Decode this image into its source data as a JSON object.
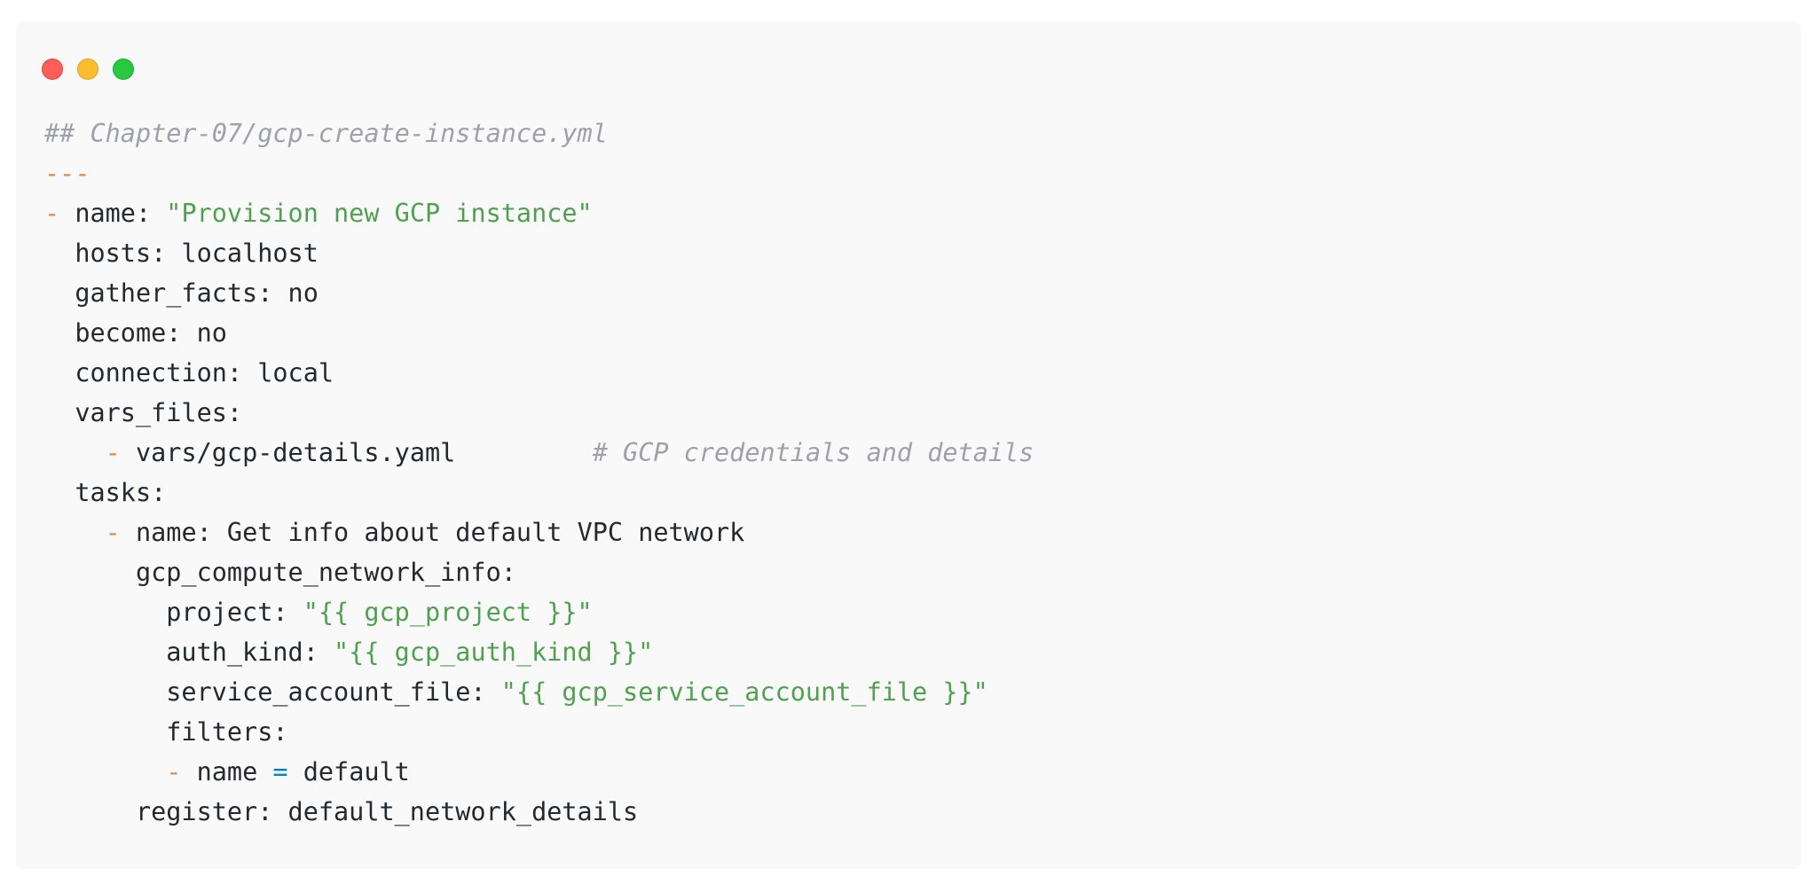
{
  "window": {
    "controls": [
      "close-icon",
      "minimize-icon",
      "zoom-icon"
    ],
    "colors": {
      "close": "#ff5f56",
      "minimize": "#ffbd2e",
      "zoom": "#27c93f",
      "background": "#f9f9f9"
    }
  },
  "code": {
    "language": "yaml",
    "colors": {
      "comment": "#a0a1a7",
      "dash": "#e08a4a",
      "string": "#50a14f",
      "operator": "#0184bc",
      "text": "#24292e"
    },
    "lines": [
      [
        {
          "t": "## Chapter-07/gcp-create-instance.yml",
          "c": "comment"
        }
      ],
      [
        {
          "t": "---",
          "c": "dash"
        }
      ],
      [
        {
          "t": "- ",
          "c": "dash"
        },
        {
          "t": "name: ",
          "c": ""
        },
        {
          "t": "\"Provision new GCP instance\"",
          "c": "str"
        }
      ],
      [
        {
          "t": "  hosts: localhost",
          "c": ""
        }
      ],
      [
        {
          "t": "  gather_facts: no",
          "c": ""
        }
      ],
      [
        {
          "t": "  become: no",
          "c": ""
        }
      ],
      [
        {
          "t": "  connection: local",
          "c": ""
        }
      ],
      [
        {
          "t": "  vars_files:",
          "c": ""
        }
      ],
      [
        {
          "t": "    ",
          "c": ""
        },
        {
          "t": "- ",
          "c": "dash"
        },
        {
          "t": "vars/gcp-details.yaml         ",
          "c": ""
        },
        {
          "t": "# GCP credentials and details",
          "c": "comment"
        }
      ],
      [
        {
          "t": "  tasks:",
          "c": ""
        }
      ],
      [
        {
          "t": "    ",
          "c": ""
        },
        {
          "t": "- ",
          "c": "dash"
        },
        {
          "t": "name: Get info about default VPC network",
          "c": ""
        }
      ],
      [
        {
          "t": "      gcp_compute_network_info:",
          "c": ""
        }
      ],
      [
        {
          "t": "        project: ",
          "c": ""
        },
        {
          "t": "\"{{ gcp_project }}\"",
          "c": "str"
        }
      ],
      [
        {
          "t": "        auth_kind: ",
          "c": ""
        },
        {
          "t": "\"{{ gcp_auth_kind }}\"",
          "c": "str"
        }
      ],
      [
        {
          "t": "        service_account_file: ",
          "c": ""
        },
        {
          "t": "\"{{ gcp_service_account_file }}\"",
          "c": "str"
        }
      ],
      [
        {
          "t": "        filters:",
          "c": ""
        }
      ],
      [
        {
          "t": "        ",
          "c": ""
        },
        {
          "t": "- ",
          "c": "dash"
        },
        {
          "t": "name ",
          "c": ""
        },
        {
          "t": "=",
          "c": "op"
        },
        {
          "t": " default",
          "c": ""
        }
      ],
      [
        {
          "t": "      register: default_network_details",
          "c": ""
        }
      ]
    ]
  }
}
